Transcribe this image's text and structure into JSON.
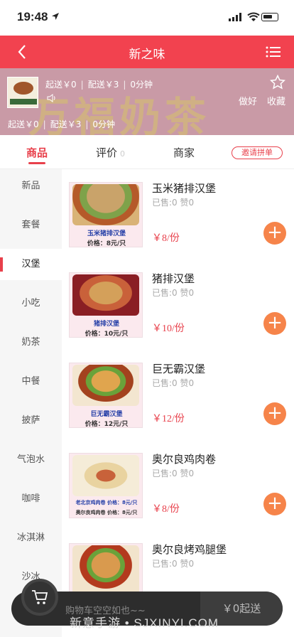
{
  "status_bar": {
    "time": "19:48"
  },
  "header": {
    "title": "新之味"
  },
  "shop": {
    "row1": {
      "min_order": "起送￥0",
      "delivery_fee": "配送￥3",
      "time": "0分钟"
    },
    "row2": {
      "min_order": "起送￥0",
      "delivery_fee": "配送￥3",
      "time": "0分钟"
    },
    "banner_text": "万福奶茶",
    "good_label": "做好",
    "fav_label": "收藏"
  },
  "tabs": [
    {
      "label": "商品",
      "count": ""
    },
    {
      "label": "评价",
      "count": "0"
    },
    {
      "label": "商家",
      "count": ""
    }
  ],
  "invite_label": "邀请拼单",
  "categories": [
    "新品",
    "套餐",
    "汉堡",
    "小吃",
    "奶茶",
    "中餐",
    "披萨",
    "气泡水",
    "咖啡",
    "冰淇淋",
    "沙冰"
  ],
  "foods": [
    {
      "name": "玉米猪排汉堡",
      "sold": "已售:0 赞0",
      "price": "￥8/份",
      "cap1": "玉米猪排汉堡",
      "cap2": "价格：8元/只"
    },
    {
      "name": "猪排汉堡",
      "sold": "已售:0 赞0",
      "price": "￥10/份",
      "cap1": "猪排汉堡",
      "cap2": "价格：10元/只"
    },
    {
      "name": "巨无霸汉堡",
      "sold": "已售:0 赞0",
      "price": "￥12/份",
      "cap1": "巨无霸汉堡",
      "cap2": "价格：12元/只"
    },
    {
      "name": "奥尔良鸡肉卷",
      "sold": "已售:0 赞0",
      "price": "￥8/份",
      "cap1": "老北京鸡肉卷 价格：8元/只",
      "cap2": "奥尔良鸡肉卷 价格：8元/只"
    },
    {
      "name": "奥尔良烤鸡腿堡",
      "sold": "已售:0 赞0",
      "price": "",
      "cap1": "",
      "cap2": ""
    }
  ],
  "cart": {
    "empty_text": "购物车空空如也~~",
    "checkout_label": "￥0起送"
  },
  "watermark": "新意手游 • SJXINYI.COM",
  "colors": {
    "brand_red": "#f2424f",
    "add_orange": "#f6844a"
  }
}
